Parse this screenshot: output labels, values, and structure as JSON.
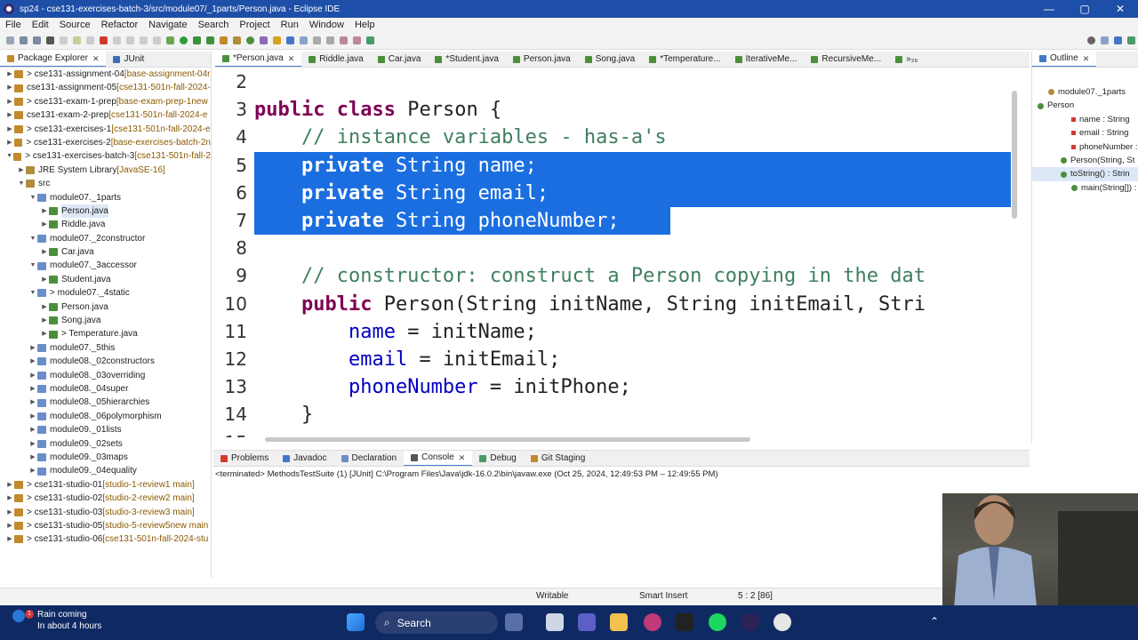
{
  "window": {
    "title": "sp24 - cse131-exercises-batch-3/src/module07/_1parts/Person.java - Eclipse IDE",
    "controls": [
      "—",
      "▢",
      "✕"
    ]
  },
  "menu": [
    "File",
    "Edit",
    "Source",
    "Refactor",
    "Navigate",
    "Search",
    "Project",
    "Run",
    "Window",
    "Help"
  ],
  "package_explorer": {
    "tabs": [
      "Package Explorer",
      "JUnit"
    ],
    "items": [
      {
        "indent": 0,
        "arrow": ">",
        "label": "> cse131-assignment-04",
        "deco": " [base-assignment-04r"
      },
      {
        "indent": 0,
        "arrow": ">",
        "label": "cse131-assignment-05",
        "deco": " [cse131-501n-fall-2024-"
      },
      {
        "indent": 0,
        "arrow": ">",
        "label": "> cse131-exam-1-prep",
        "deco": " [base-exam-prep-1new"
      },
      {
        "indent": 0,
        "arrow": ">",
        "label": "cse131-exam-2-prep",
        "deco": " [cse131-501n-fall-2024-e"
      },
      {
        "indent": 0,
        "arrow": ">",
        "label": "> cse131-exercises-1",
        "deco": " [cse131-501n-fall-2024-e"
      },
      {
        "indent": 0,
        "arrow": ">",
        "label": "> cse131-exercises-2",
        "deco": " [base-exercises-batch-2n"
      },
      {
        "indent": 0,
        "arrow": "v",
        "label": "> cse131-exercises-batch-3",
        "deco": " [cse131-501n-fall-2"
      },
      {
        "indent": 1,
        "arrow": ">",
        "label": "JRE System Library",
        "deco": " [JavaSE-16]"
      },
      {
        "indent": 1,
        "arrow": "v",
        "label": "src",
        "deco": ""
      },
      {
        "indent": 2,
        "arrow": "v",
        "label": "module07._1parts",
        "deco": ""
      },
      {
        "indent": 3,
        "arrow": ">",
        "label": "Person.java",
        "deco": "",
        "selected": true
      },
      {
        "indent": 3,
        "arrow": ">",
        "label": "Riddle.java",
        "deco": ""
      },
      {
        "indent": 2,
        "arrow": "v",
        "label": "module07._2constructor",
        "deco": ""
      },
      {
        "indent": 3,
        "arrow": ">",
        "label": "Car.java",
        "deco": ""
      },
      {
        "indent": 2,
        "arrow": "v",
        "label": "module07._3accessor",
        "deco": ""
      },
      {
        "indent": 3,
        "arrow": ">",
        "label": "Student.java",
        "deco": ""
      },
      {
        "indent": 2,
        "arrow": "v",
        "label": "> module07._4static",
        "deco": ""
      },
      {
        "indent": 3,
        "arrow": ">",
        "label": "Person.java",
        "deco": ""
      },
      {
        "indent": 3,
        "arrow": ">",
        "label": "Song.java",
        "deco": ""
      },
      {
        "indent": 3,
        "arrow": ">",
        "label": "> Temperature.java",
        "deco": ""
      },
      {
        "indent": 2,
        "arrow": ">",
        "label": "module07._5this",
        "deco": ""
      },
      {
        "indent": 2,
        "arrow": ">",
        "label": "module08._02constructors",
        "deco": ""
      },
      {
        "indent": 2,
        "arrow": ">",
        "label": "module08._03overriding",
        "deco": ""
      },
      {
        "indent": 2,
        "arrow": ">",
        "label": "module08._04super",
        "deco": ""
      },
      {
        "indent": 2,
        "arrow": ">",
        "label": "module08._05hierarchies",
        "deco": ""
      },
      {
        "indent": 2,
        "arrow": ">",
        "label": "module08._06polymorphism",
        "deco": ""
      },
      {
        "indent": 2,
        "arrow": ">",
        "label": "module09._01lists",
        "deco": ""
      },
      {
        "indent": 2,
        "arrow": ">",
        "label": "module09._02sets",
        "deco": ""
      },
      {
        "indent": 2,
        "arrow": ">",
        "label": "module09._03maps",
        "deco": ""
      },
      {
        "indent": 2,
        "arrow": ">",
        "label": "module09._04equality",
        "deco": ""
      },
      {
        "indent": 0,
        "arrow": ">",
        "label": "> cse131-studio-01",
        "deco": " [studio-1-review1 main]"
      },
      {
        "indent": 0,
        "arrow": ">",
        "label": "> cse131-studio-02",
        "deco": " [studio-2-review2 main]"
      },
      {
        "indent": 0,
        "arrow": ">",
        "label": "> cse131-studio-03",
        "deco": " [studio-3-review3 main]"
      },
      {
        "indent": 0,
        "arrow": ">",
        "label": "> cse131-studio-05",
        "deco": " [studio-5-review5new main"
      },
      {
        "indent": 0,
        "arrow": ">",
        "label": "> cse131-studio-06",
        "deco": " [cse131-501n-fall-2024-stu"
      }
    ]
  },
  "editor": {
    "tabs": [
      {
        "label": "*Person.java",
        "active": true,
        "close": "✕"
      },
      {
        "label": "Riddle.java"
      },
      {
        "label": "Car.java"
      },
      {
        "label": "*Student.java"
      },
      {
        "label": "Person.java"
      },
      {
        "label": "Song.java"
      },
      {
        "label": "*Temperature..."
      },
      {
        "label": "IterativeMe..."
      },
      {
        "label": "RecursiveMe..."
      },
      {
        "label": "»₂₆"
      }
    ],
    "lines": [
      {
        "num": "2",
        "text": ""
      },
      {
        "num": "3",
        "text": "public class Person {"
      },
      {
        "num": "4",
        "text": "    // instance variables - has-a's"
      },
      {
        "num": "5",
        "text": "    private String name;"
      },
      {
        "num": "6",
        "text": "    private String email;"
      },
      {
        "num": "7",
        "text": "    private String phoneNumber;"
      },
      {
        "num": "8",
        "text": ""
      },
      {
        "num": "9",
        "text": "    // constructor: construct a Person copying in the dat"
      },
      {
        "num": "10",
        "text": "    public Person(String initName, String initEmail, Stri"
      },
      {
        "num": "11",
        "text": "        name = initName;"
      },
      {
        "num": "12",
        "text": "        email = initEmail;"
      },
      {
        "num": "13",
        "text": "        phoneNumber = initPhone;"
      },
      {
        "num": "14",
        "text": "    }"
      },
      {
        "num": "15",
        "text": ""
      }
    ]
  },
  "outline": {
    "tab": "Outline",
    "items": [
      {
        "label": "module07._1parts",
        "kind": "package"
      },
      {
        "label": "Person",
        "kind": "class"
      },
      {
        "label": "name : String",
        "kind": "field"
      },
      {
        "label": "email : String",
        "kind": "field"
      },
      {
        "label": "phoneNumber :",
        "kind": "field"
      },
      {
        "label": "Person(String, St",
        "kind": "ctor"
      },
      {
        "label": "toString() : Strin",
        "kind": "method",
        "selected": true
      },
      {
        "label": "main(String[]) :",
        "kind": "static"
      }
    ]
  },
  "console": {
    "tabs": [
      "Problems",
      "Javadoc",
      "Declaration",
      "Console",
      "Debug",
      "Git Staging"
    ],
    "active": "Console",
    "terminated": "<terminated> MethodsTestSuite (1) [JUnit] C:\\Program Files\\Java\\jdk-16.0.2\\bin\\javaw.exe  (Oct 25, 2024, 12:49:53 PM – 12:49:55 PM)"
  },
  "status": {
    "writable": "Writable",
    "insert": "Smart Insert",
    "position": "5 : 2 [86]"
  },
  "taskbar": {
    "weather_title": "Rain coming",
    "weather_sub": "In about 4 hours",
    "badge": "1",
    "search_placeholder": "Search"
  },
  "colors": {
    "titlebar": "#1e4fa8",
    "selection": "#1b6ee0",
    "keyword": "#7f0055",
    "comment": "#3f7f5f",
    "field": "#0000c0",
    "taskbar": "#0f2a63"
  }
}
